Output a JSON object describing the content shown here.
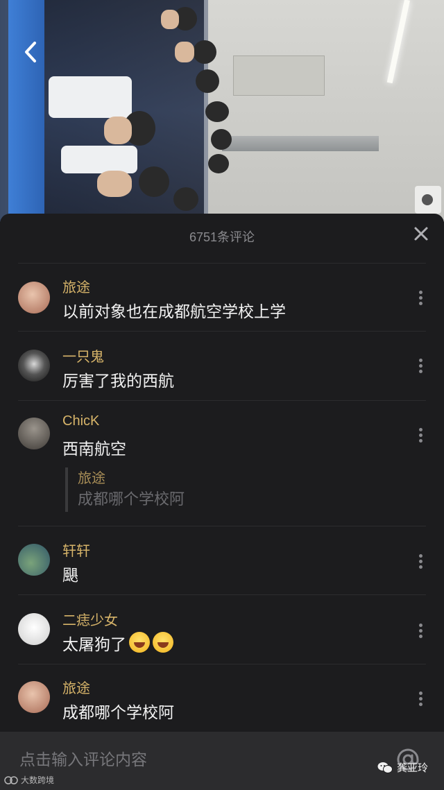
{
  "video": {
    "back_icon": "chevron-left-icon"
  },
  "sheet": {
    "title": "6751条评论",
    "close_icon": "close-icon"
  },
  "comments": [
    {
      "author": "旅途",
      "text": "以前对象也在成都航空学校上学",
      "avatar_color": "#c98f7a"
    },
    {
      "author": "一只鬼",
      "text": "厉害了我的西航",
      "avatar_color": "#3a3a3a"
    },
    {
      "author": "ChicK",
      "text": "西南航空",
      "avatar_color": "#6f6a64",
      "reply": {
        "author": "旅途",
        "text": "成都哪个学校阿"
      }
    },
    {
      "author": "轩轩",
      "text": "颶",
      "avatar_color": "#4b7a86"
    },
    {
      "author": "二痣少女",
      "text": "太屠狗了",
      "avatar_color": "#e8e8e8",
      "emoji": [
        "laughing-crying-emoji",
        "laughing-crying-emoji"
      ]
    },
    {
      "author": "旅途",
      "text": "成都哪个学校阿",
      "avatar_color": "#c98f7a"
    }
  ],
  "input": {
    "placeholder": "点击输入评论内容",
    "at_icon": "at-icon"
  },
  "watermarks": {
    "left": "大数跨境",
    "right": "龚亚玲"
  },
  "colors": {
    "sheet_bg": "#1c1c1e",
    "author": "#d8b56a",
    "text": "#f2f2f2",
    "muted": "#8a8a8e"
  }
}
